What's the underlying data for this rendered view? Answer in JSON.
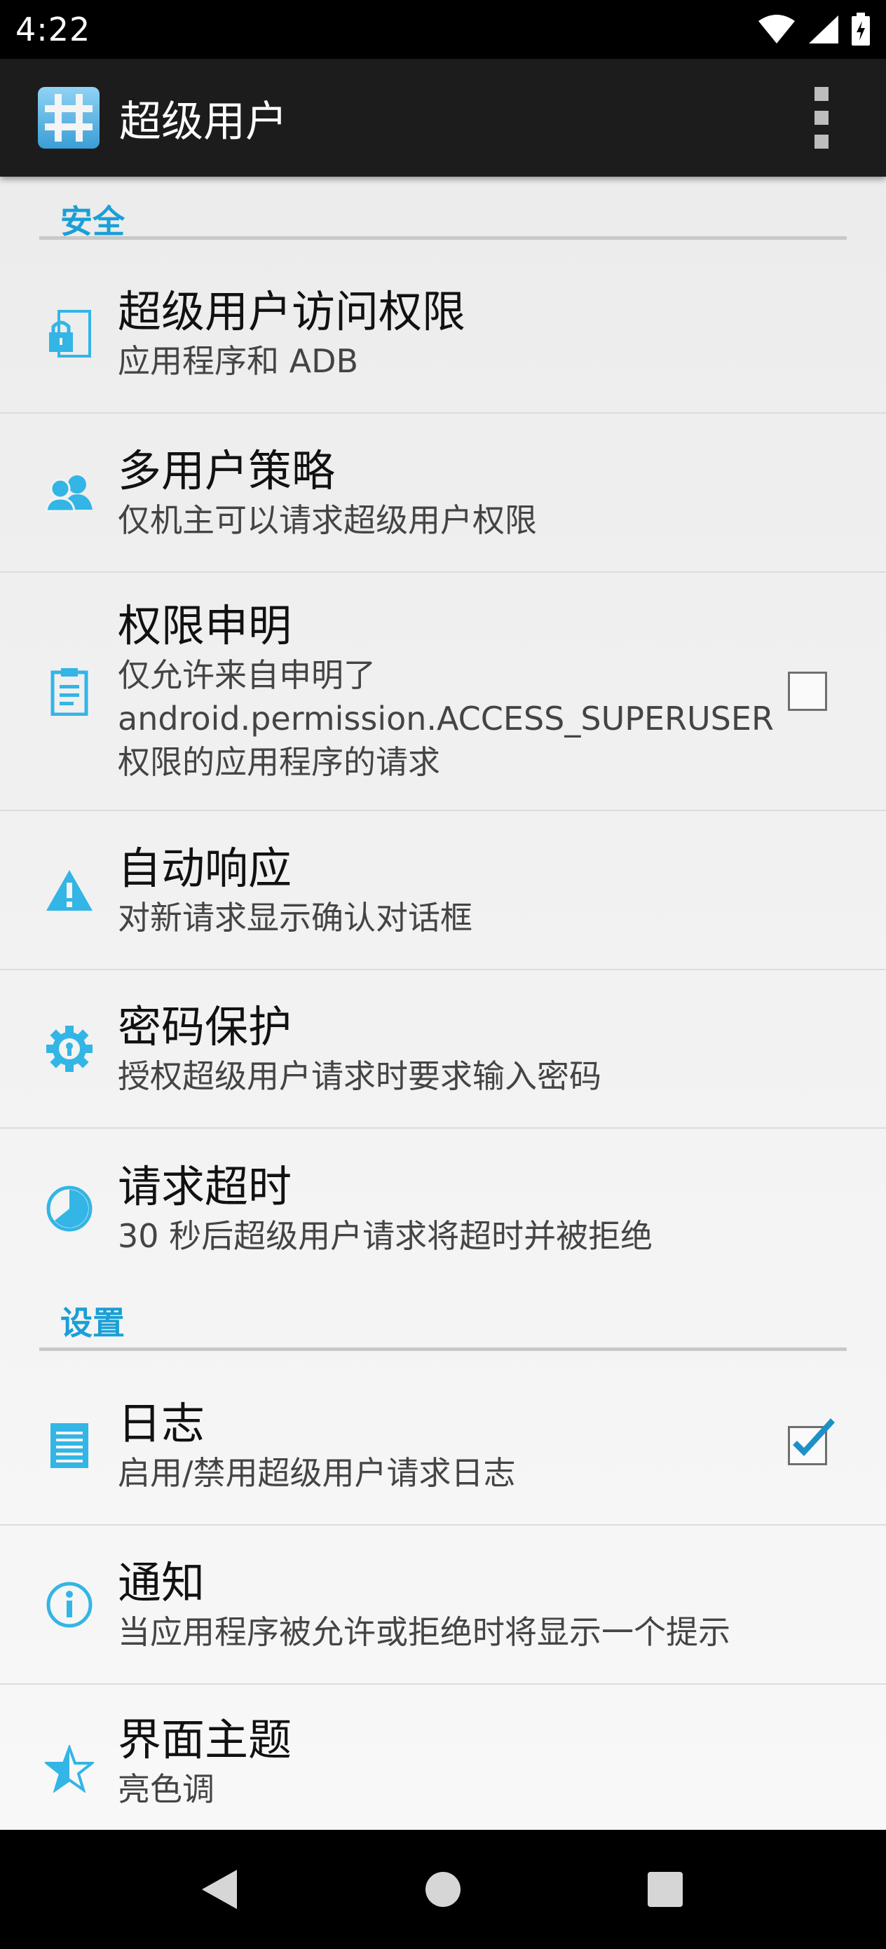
{
  "status_bar": {
    "time": "4:22"
  },
  "app_bar": {
    "title": "超级用户"
  },
  "sections": [
    {
      "header": "安全",
      "items": [
        {
          "title": "超级用户访问权限",
          "summary": "应用程序和 ADB",
          "icon": "lock-icon"
        },
        {
          "title": "多用户策略",
          "summary": "仅机主可以请求超级用户权限",
          "icon": "users-icon"
        },
        {
          "title": "权限申明",
          "summary_lines": [
            "仅允许来自申明了",
            "android.permission.ACCESS_SUPERUSER",
            "权限的应用程序的请求"
          ],
          "icon": "clipboard-icon",
          "checkbox": false
        },
        {
          "title": "自动响应",
          "summary": "对新请求显示确认对话框",
          "icon": "warning-icon"
        },
        {
          "title": "密码保护",
          "summary": "授权超级用户请求时要求输入密码",
          "icon": "gear-icon"
        },
        {
          "title": "请求超时",
          "summary": "30 秒后超级用户请求将超时并被拒绝",
          "icon": "clock-icon"
        }
      ]
    },
    {
      "header": "设置",
      "items": [
        {
          "title": "日志",
          "summary": "启用/禁用超级用户请求日志",
          "icon": "log-icon",
          "checkbox": true
        },
        {
          "title": "通知",
          "summary": "当应用程序被允许或拒绝时将显示一个提示",
          "icon": "info-icon"
        },
        {
          "title": "界面主题",
          "summary": "亮色调",
          "icon": "star-icon"
        }
      ]
    }
  ],
  "colors": {
    "accent": "#1a9fd6",
    "icon": "#33b5e5",
    "check": "#1e90c8"
  }
}
